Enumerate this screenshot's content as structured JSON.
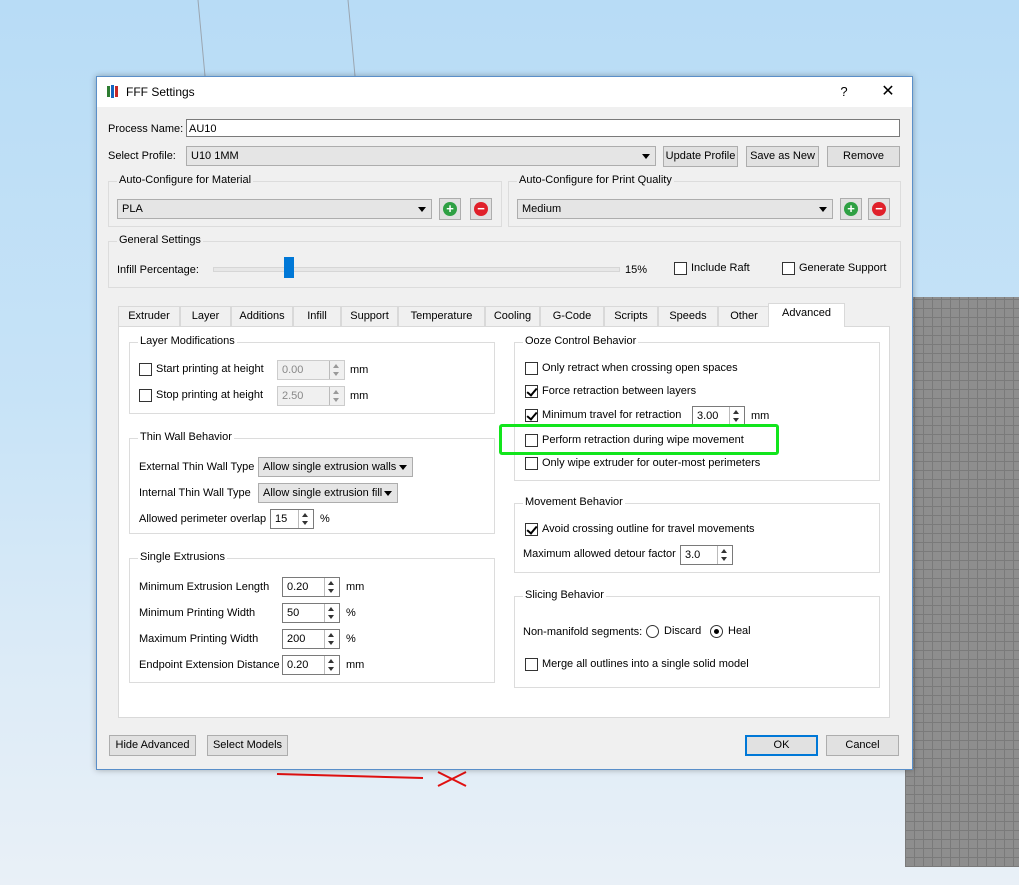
{
  "dialog": {
    "title": "FFF Settings",
    "help": "?",
    "close": "✕"
  },
  "process": {
    "name_label": "Process Name:",
    "name_value": "AU10",
    "profile_label": "Select Profile:",
    "profile_value": "U10 1MM",
    "update_profile": "Update Profile",
    "save_as_new": "Save as New",
    "remove": "Remove"
  },
  "material": {
    "group_title": "Auto-Configure for Material",
    "value": "PLA"
  },
  "quality": {
    "group_title": "Auto-Configure for Print Quality",
    "value": "Medium"
  },
  "general": {
    "group_title": "General Settings",
    "infill_label": "Infill Percentage:",
    "infill_value": "15%",
    "infill_fraction": 0.15,
    "include_raft": "Include Raft",
    "generate_support": "Generate Support"
  },
  "tabs": [
    "Extruder",
    "Layer",
    "Additions",
    "Infill",
    "Support",
    "Temperature",
    "Cooling",
    "G-Code",
    "Scripts",
    "Speeds",
    "Other",
    "Advanced"
  ],
  "layer_mod": {
    "title": "Layer Modifications",
    "start_label": "Start printing at height",
    "start_value": "0.00",
    "stop_label": "Stop printing at height",
    "stop_value": "2.50",
    "unit": "mm"
  },
  "thin_wall": {
    "title": "Thin Wall Behavior",
    "external_label": "External Thin Wall Type",
    "external_value": "Allow single extrusion walls",
    "internal_label": "Internal Thin Wall Type",
    "internal_value": "Allow single extrusion fill",
    "overlap_label": "Allowed perimeter overlap",
    "overlap_value": "15",
    "overlap_unit": "%"
  },
  "single_ext": {
    "title": "Single Extrusions",
    "min_len_label": "Minimum Extrusion Length",
    "min_len_value": "0.20",
    "min_len_unit": "mm",
    "min_width_label": "Minimum Printing Width",
    "min_width_value": "50",
    "min_width_unit": "%",
    "max_width_label": "Maximum Printing Width",
    "max_width_value": "200",
    "max_width_unit": "%",
    "endpoint_label": "Endpoint Extension Distance",
    "endpoint_value": "0.20",
    "endpoint_unit": "mm"
  },
  "ooze": {
    "title": "Ooze Control Behavior",
    "only_retract": "Only retract when crossing open spaces",
    "force_retract": "Force retraction between layers",
    "min_travel": "Minimum travel for retraction",
    "min_travel_value": "3.00",
    "min_travel_unit": "mm",
    "perform_wipe": "Perform retraction during wipe movement",
    "only_wipe": "Only wipe extruder for outer-most perimeters"
  },
  "movement": {
    "title": "Movement Behavior",
    "avoid_crossing": "Avoid crossing outline for travel movements",
    "detour_label": "Maximum allowed detour factor",
    "detour_value": "3.0"
  },
  "slicing": {
    "title": "Slicing Behavior",
    "nonmanifold_label": "Non-manifold segments:",
    "discard": "Discard",
    "heal": "Heal",
    "merge": "Merge all outlines into a single solid model"
  },
  "footer": {
    "hide_advanced": "Hide Advanced",
    "select_models": "Select Models",
    "ok": "OK",
    "cancel": "Cancel"
  },
  "colors": {
    "accent": "#0078d7",
    "highlight": "#12e51c",
    "add": "#2ea043",
    "remove": "#e0202a"
  }
}
